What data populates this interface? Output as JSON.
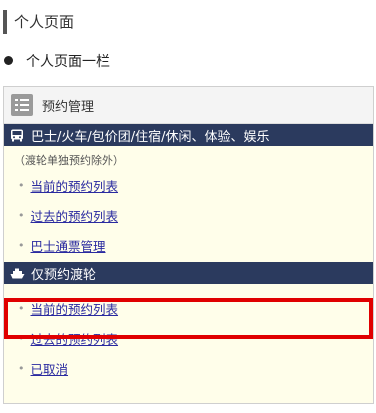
{
  "page_title": "个人页面",
  "section_heading": "个人页面一栏",
  "panel": {
    "title": "预约管理",
    "bus_band": {
      "icon": "bus-icon",
      "label": "巴士/火车/包价团/住宿/休闲、体验、娱乐",
      "note": "（渡轮单独预约除外）",
      "links": [
        "当前的预约列表",
        "过去的预约列表",
        "巴士通票管理"
      ]
    },
    "ferry_band": {
      "icon": "ship-icon",
      "label": "仅预约渡轮",
      "links": [
        "当前的预约列表",
        "过去的预约列表",
        "已取消"
      ]
    }
  },
  "colors": {
    "band_bg": "#2b3a5e",
    "panel_bg": "#fffeea",
    "link": "#2a2aa0",
    "highlight": "#e00000"
  }
}
